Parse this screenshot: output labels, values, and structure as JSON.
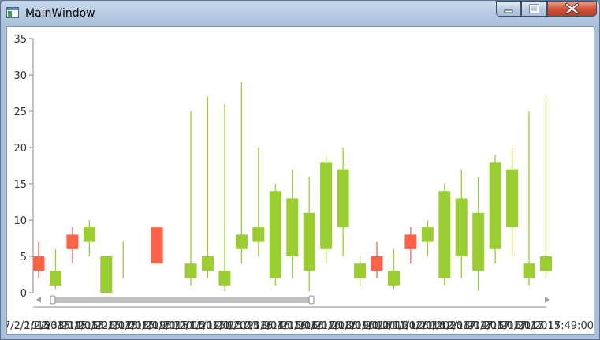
{
  "window": {
    "title": "MainWindow",
    "controls": [
      "minimize-icon",
      "maximize-icon",
      "close-icon"
    ]
  },
  "chart_data": {
    "type": "candlestick",
    "ylim": [
      0,
      35
    ],
    "yticks": [
      0,
      5,
      10,
      15,
      20,
      25,
      30,
      35
    ],
    "grid": false,
    "colors": {
      "up": "#9acd32",
      "down": "#ff6347",
      "axis": "#888888",
      "scrollbar": "#c0c0c0"
    },
    "x_labels": [
      "7/2/2015",
      "1/2/2015",
      "2/3/2015",
      "3/1/2015",
      "4/1/2015",
      "5/2/2015",
      "6/1/2015",
      "7/1/2015",
      "8/1/2015",
      "9/1/2015",
      "10/1/2015",
      "11/1/2015",
      "12/1/2015",
      "1/1/2016",
      "2/1/2016",
      "3/1/2016",
      "4/1/2016",
      "5/1/2016",
      "6/1/2016",
      "7/1/2016",
      "8/1/2016",
      "9/1/2016",
      "10/1/2016",
      "11/1/2016",
      "12/1/2016",
      "1/1/2017",
      "2/1/2017",
      "3/1/2017",
      "4/1/2017",
      "5/1/2017",
      "6/1/2017",
      "15:15:49:00"
    ],
    "candles": [
      {
        "open": 5,
        "close": 3,
        "high": 7,
        "low": 2
      },
      {
        "open": 1,
        "close": 3,
        "high": 6,
        "low": 0.5
      },
      {
        "open": 8,
        "close": 6,
        "high": 9,
        "low": 4
      },
      {
        "open": 7,
        "close": 9,
        "high": 10,
        "low": 5
      },
      {
        "open": 0,
        "close": 5,
        "high": 5,
        "low": 0
      },
      {
        "open": 7,
        "close": 7,
        "high": 7,
        "low": 2
      },
      null,
      {
        "open": 9,
        "close": 4,
        "high": 9,
        "low": 4
      },
      null,
      {
        "open": 2,
        "close": 4,
        "high": 25,
        "low": 1
      },
      {
        "open": 3,
        "close": 5,
        "high": 27,
        "low": 2
      },
      {
        "open": 1,
        "close": 3,
        "high": 26,
        "low": 0.2
      },
      {
        "open": 6,
        "close": 8,
        "high": 29,
        "low": 4
      },
      {
        "open": 7,
        "close": 9,
        "high": 20,
        "low": 5
      },
      {
        "open": 2,
        "close": 14,
        "high": 15,
        "low": 1
      },
      {
        "open": 5,
        "close": 13,
        "high": 17,
        "low": 2
      },
      {
        "open": 3,
        "close": 11,
        "high": 16,
        "low": 0.2
      },
      {
        "open": 6,
        "close": 18,
        "high": 19,
        "low": 4
      },
      {
        "open": 9,
        "close": 17,
        "high": 20,
        "low": 5
      },
      {
        "open": 2,
        "close": 4,
        "high": 5,
        "low": 1
      },
      {
        "open": 5,
        "close": 3,
        "high": 7,
        "low": 2
      },
      {
        "open": 1,
        "close": 3,
        "high": 6,
        "low": 0.5
      },
      {
        "open": 8,
        "close": 6,
        "high": 9,
        "low": 4
      },
      {
        "open": 7,
        "close": 9,
        "high": 10,
        "low": 5
      },
      {
        "open": 2,
        "close": 14,
        "high": 15,
        "low": 1
      },
      {
        "open": 5,
        "close": 13,
        "high": 17,
        "low": 2
      },
      {
        "open": 3,
        "close": 11,
        "high": 16,
        "low": 0.2
      },
      {
        "open": 6,
        "close": 18,
        "high": 19,
        "low": 4
      },
      {
        "open": 9,
        "close": 17,
        "high": 20,
        "low": 5
      },
      {
        "open": 2,
        "close": 4,
        "high": 25,
        "low": 1
      },
      {
        "open": 3,
        "close": 5,
        "high": 27,
        "low": 2
      }
    ],
    "scrollbar": {
      "start": 0.03,
      "end": 0.54
    }
  }
}
